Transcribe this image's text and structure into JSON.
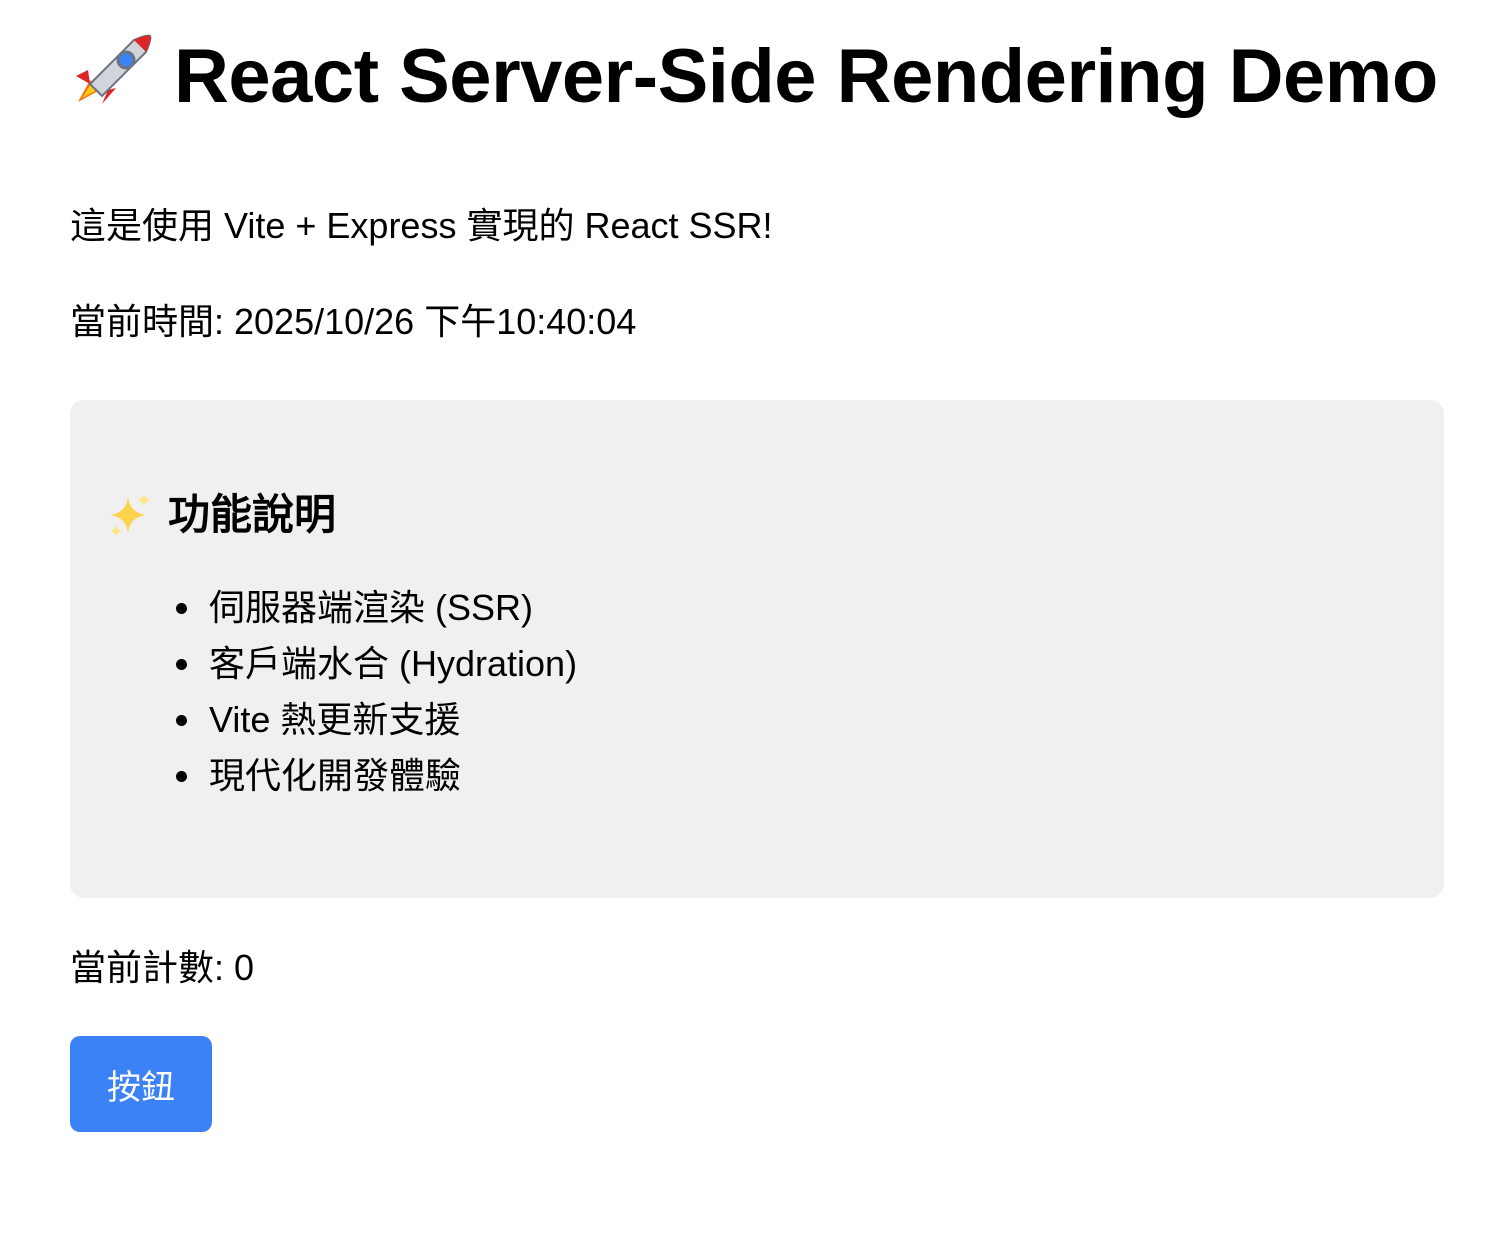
{
  "header": {
    "icon": "rocket-icon",
    "title": "React Server-Side Rendering Demo"
  },
  "intro_text": "這是使用 Vite + Express 實現的 React SSR!",
  "time": {
    "label": "當前時間: ",
    "value": "2025/10/26 下午10:40:04"
  },
  "features": {
    "icon": "sparkles-icon",
    "title": "功能說明",
    "items": [
      "伺服器端渲染 (SSR)",
      "客戶端水合 (Hydration)",
      "Vite 熱更新支援",
      "現代化開發體驗"
    ]
  },
  "counter": {
    "label": "當前計數: ",
    "value": "0"
  },
  "button": {
    "label": "按鈕"
  },
  "colors": {
    "background": "#ffffff",
    "panel": "#f0f0f0",
    "button": "#3b82f6",
    "button_text": "#ffffff"
  }
}
